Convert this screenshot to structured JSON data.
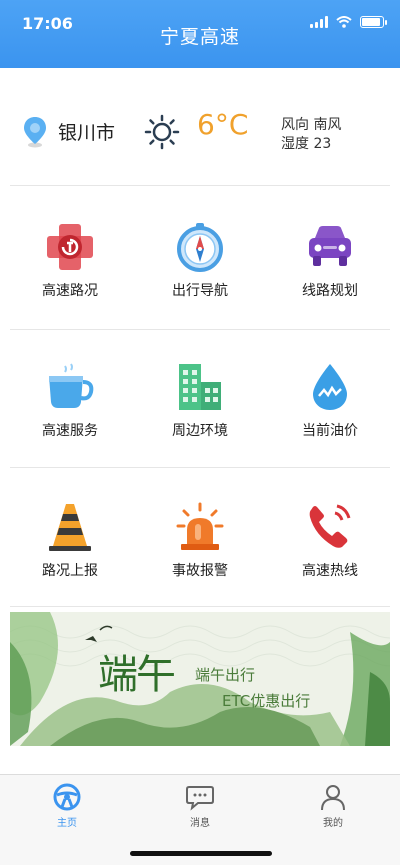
{
  "status": {
    "time": "17:06"
  },
  "header": {
    "title": "宁夏高速"
  },
  "weather": {
    "city": "银川市",
    "temperature": "6°C",
    "wind": "风向 南风",
    "humidity": "湿度 23"
  },
  "grid": [
    {
      "label": "高速路况",
      "icon": "traffic-status-icon"
    },
    {
      "label": "出行导航",
      "icon": "compass-icon"
    },
    {
      "label": "线路规划",
      "icon": "car-icon"
    },
    {
      "label": "高速服务",
      "icon": "cup-icon"
    },
    {
      "label": "周边环境",
      "icon": "buildings-icon"
    },
    {
      "label": "当前油价",
      "icon": "oil-drop-icon"
    },
    {
      "label": "路况上报",
      "icon": "traffic-cone-icon"
    },
    {
      "label": "事故报警",
      "icon": "alarm-light-icon"
    },
    {
      "label": "高速热线",
      "icon": "phone-icon"
    }
  ],
  "banner": {
    "big_text": "端午",
    "line1": "端午出行",
    "line2": "ETC优惠出行"
  },
  "tabs": [
    {
      "label": "主页",
      "icon": "steering-wheel-icon",
      "active": true
    },
    {
      "label": "消息",
      "icon": "message-icon",
      "active": false
    },
    {
      "label": "我的",
      "icon": "user-icon",
      "active": false
    }
  ],
  "colors": {
    "header_blue": "#3b94ef",
    "temperature_orange": "#f0a12c",
    "active_tab": "#3b94ef"
  }
}
